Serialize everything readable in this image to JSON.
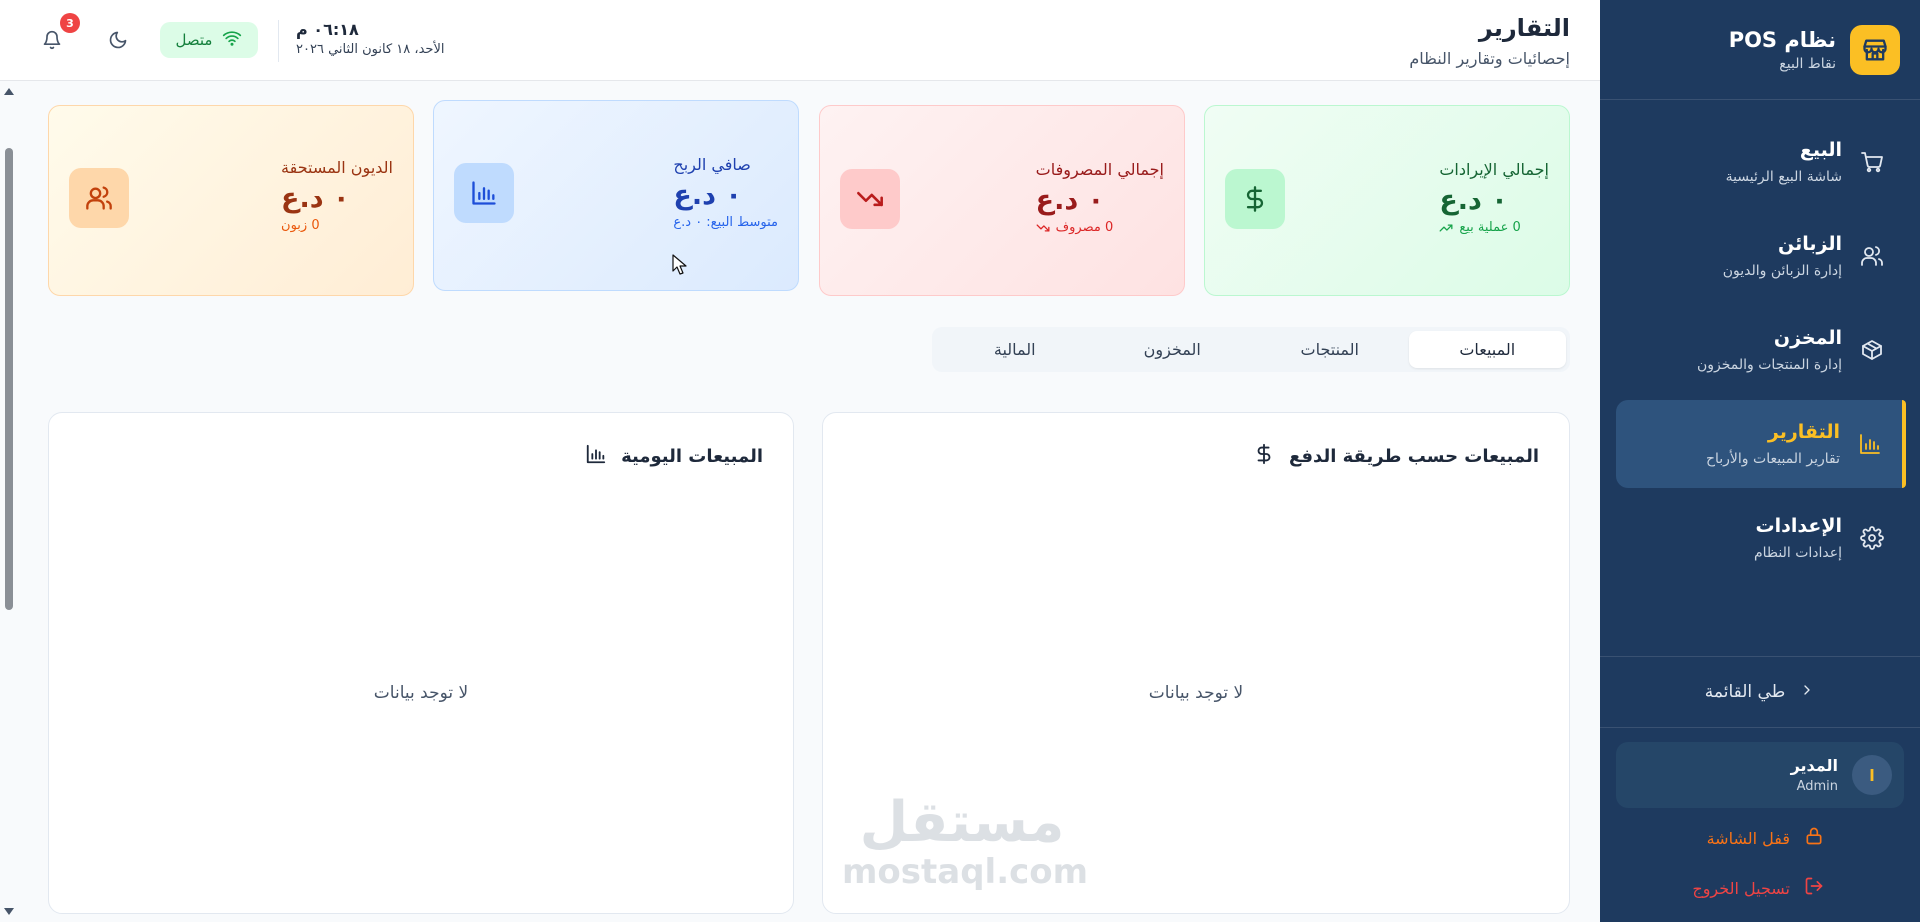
{
  "colors": {
    "sidebar_bg": "#1e3a5f",
    "accent": "#fbbf24",
    "green": "#16a34a",
    "red": "#dc2626",
    "blue": "#2563eb",
    "orange": "#ea580c"
  },
  "sidebar": {
    "brand": {
      "title": "نظام POS",
      "subtitle": "نقاط البيع",
      "icon": "store-icon"
    },
    "items": [
      {
        "label": "البيع",
        "desc": "شاشة البيع الرئيسية",
        "icon": "cart-icon"
      },
      {
        "label": "الزبائن",
        "desc": "إدارة الزبائن والديون",
        "icon": "users-icon"
      },
      {
        "label": "المخزن",
        "desc": "إدارة المنتجات والمخزون",
        "icon": "box-icon"
      },
      {
        "label": "التقارير",
        "desc": "تقارير المبيعات والأرباح",
        "icon": "bar-chart-icon",
        "active": true
      },
      {
        "label": "الإعدادات",
        "desc": "إعدادات النظام",
        "icon": "gear-icon"
      }
    ],
    "collapse_label": "طي القائمة",
    "user": {
      "initial": "ا",
      "name": "المدير",
      "role": "Admin"
    },
    "lock_label": "قفل الشاشة",
    "logout_label": "تسجيل الخروج"
  },
  "header": {
    "title": "التقارير",
    "subtitle": "إحصائيات وتقارير النظام",
    "time": "٠٦:١٨ م",
    "date": "الأحد، ١٨ كانون الثاني ٢٠٢٦",
    "status": "متصل",
    "notifications_count": "3"
  },
  "stats": [
    {
      "title": "إجمالي الإيرادات",
      "value": "٠ د.ع",
      "note": "0 عملية بيع",
      "icon": "dollar-icon"
    },
    {
      "title": "إجمالي المصروفات",
      "value": "٠ د.ع",
      "note": "0 مصروف",
      "icon": "trending-down-icon"
    },
    {
      "title": "صافي الربح",
      "value": "٠ د.ع",
      "note": "متوسط البيع: ٠ د.ع",
      "icon": "bar-chart-icon"
    },
    {
      "title": "الديون المستحقة",
      "value": "٠ د.ع",
      "note": "0 زبون",
      "icon": "users-icon"
    }
  ],
  "tabs": [
    {
      "label": "المبيعات",
      "active": true
    },
    {
      "label": "المنتجات"
    },
    {
      "label": "المخزون"
    },
    {
      "label": "المالية"
    }
  ],
  "panels": {
    "payment": {
      "title": "المبيعات حسب طريقة الدفع",
      "empty": "لا توجد بيانات",
      "icon": "dollar-icon"
    },
    "daily": {
      "title": "المبيعات اليومية",
      "empty": "لا توجد بيانات",
      "icon": "bar-chart-icon"
    }
  },
  "watermark": {
    "arabic": "مستقل",
    "latin": "mostaql.com"
  }
}
